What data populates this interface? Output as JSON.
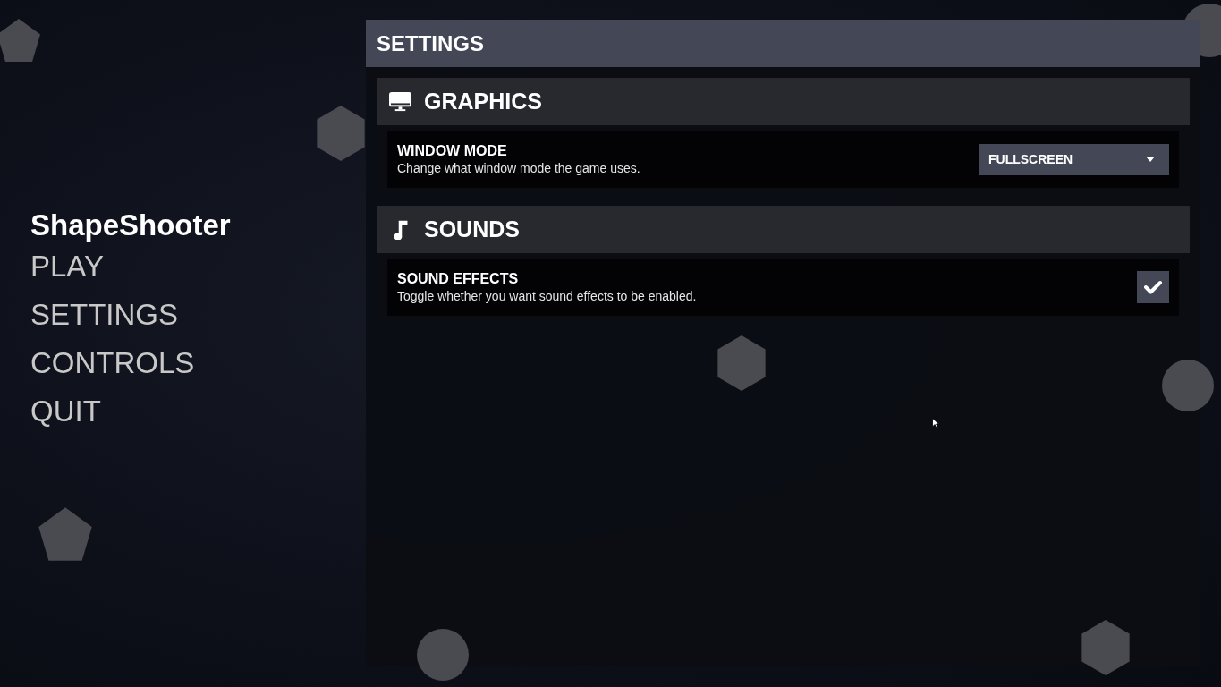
{
  "game_title": "ShapeShooter",
  "menu": [
    {
      "label": "PLAY"
    },
    {
      "label": "SETTINGS"
    },
    {
      "label": "CONTROLS"
    },
    {
      "label": "QUIT"
    }
  ],
  "panel": {
    "title": "SETTINGS"
  },
  "sections": [
    {
      "title": "GRAPHICS",
      "settings": [
        {
          "kind": "dropdown",
          "name": "WINDOW MODE",
          "description": "Change what window mode the game uses.",
          "value": "FULLSCREEN"
        }
      ]
    },
    {
      "title": "SOUNDS",
      "settings": [
        {
          "kind": "checkbox",
          "name": "SOUND EFFECTS",
          "description": "Toggle whether you want sound effects to be enabled.",
          "checked": true
        }
      ]
    }
  ]
}
